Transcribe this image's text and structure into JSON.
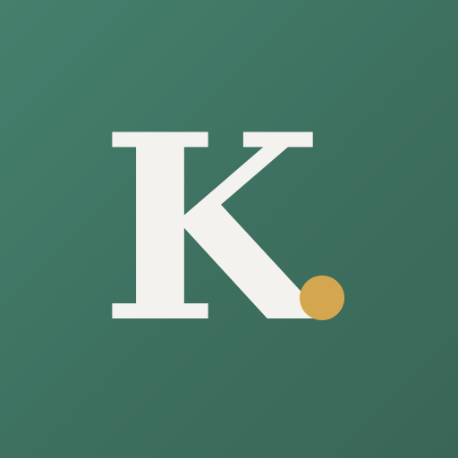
{
  "logo": {
    "letter": "K",
    "dot_icon": "period-dot",
    "colors": {
      "background": "#417866",
      "letter": "#f4f2ee",
      "dot": "#d3a64f"
    }
  }
}
